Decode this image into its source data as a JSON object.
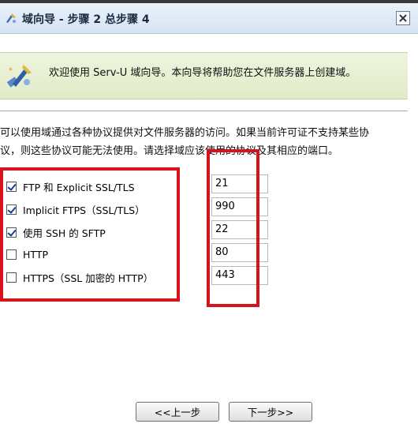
{
  "window": {
    "title": "域向导 - 步骤 2 总步骤 4",
    "close_icon": "close-icon"
  },
  "banner": {
    "icon": "wizard-icon",
    "text": "欢迎使用 Serv-U 域向导。本向导将帮助您在文件服务器上创建域。"
  },
  "description": {
    "line1": "可以使用域通过各种协议提供对文件服务器的访问。如果当前许可证不支持某些协",
    "line2": "议，则这些协议可能无法使用。请选择域应该使用的协议及其相应的端口。"
  },
  "protocols": [
    {
      "label": "FTP 和  Explicit SSL/TLS",
      "checked": true,
      "port": "21"
    },
    {
      "label": "Implicit FTPS（SSL/TLS）",
      "checked": true,
      "port": "990"
    },
    {
      "label": "使用  SSH 的  SFTP",
      "checked": true,
      "port": "22"
    },
    {
      "label": "HTTP",
      "checked": false,
      "port": "80"
    },
    {
      "label": "HTTPS（SSL 加密的  HTTP）",
      "checked": false,
      "port": "443"
    }
  ],
  "buttons": {
    "back": "<<上一步",
    "next": "下一步>>"
  },
  "colors": {
    "highlight_red": "#d8121c",
    "title_bar": "#d6e3f3",
    "banner": "#e1ebc8"
  }
}
